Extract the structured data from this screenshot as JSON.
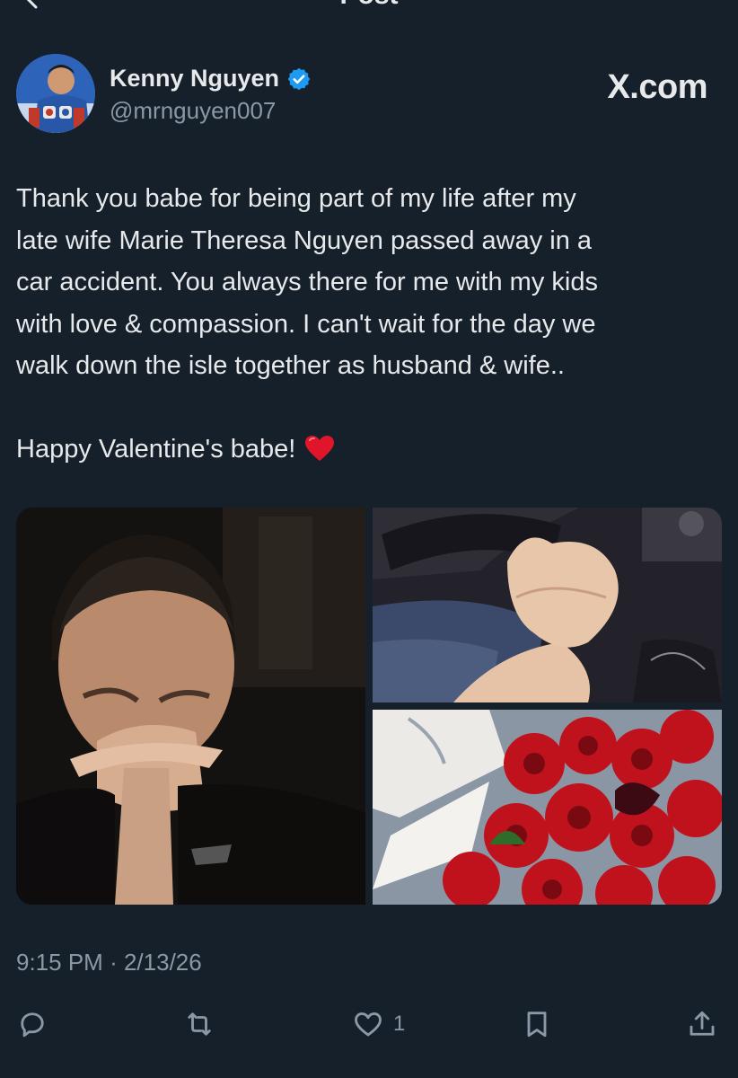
{
  "top_bar": {
    "title": "Post",
    "back_icon": "back-arrow-icon"
  },
  "author": {
    "display_name": "Kenny Nguyen",
    "handle": "@mrnguyen007",
    "verified": true,
    "verified_color": "#1d9bf0"
  },
  "source": "X.com",
  "post": {
    "lines": [
      "Thank you babe for being part of my life after my",
      "late wife Marie Theresa Nguyen passed away in a",
      "car accident. You always there for me with my kids",
      "with love & compassion. I can't wait for the day we",
      "walk down the isle together as husband & wife.."
    ],
    "closing": "Happy Valentine's babe!",
    "emoji": "red-heart"
  },
  "media": [
    {
      "description_icon": "photo-man-hands-clasped"
    },
    {
      "description_icon": "photo-holding-hands-car"
    },
    {
      "description_icon": "photo-red-roses-bouquet"
    }
  ],
  "meta": {
    "time": "9:15 PM",
    "separator": "·",
    "date": "2/13/26"
  },
  "actions": {
    "reply_icon": "reply-icon",
    "repost_icon": "repost-icon",
    "like_icon": "heart-icon",
    "like_count": "1",
    "bookmark_icon": "bookmark-icon",
    "share_icon": "share-icon"
  },
  "colors": {
    "background": "#15202b",
    "text": "#e7e9ea",
    "secondary_text": "#8b98a5",
    "accent": "#1d9bf0"
  }
}
